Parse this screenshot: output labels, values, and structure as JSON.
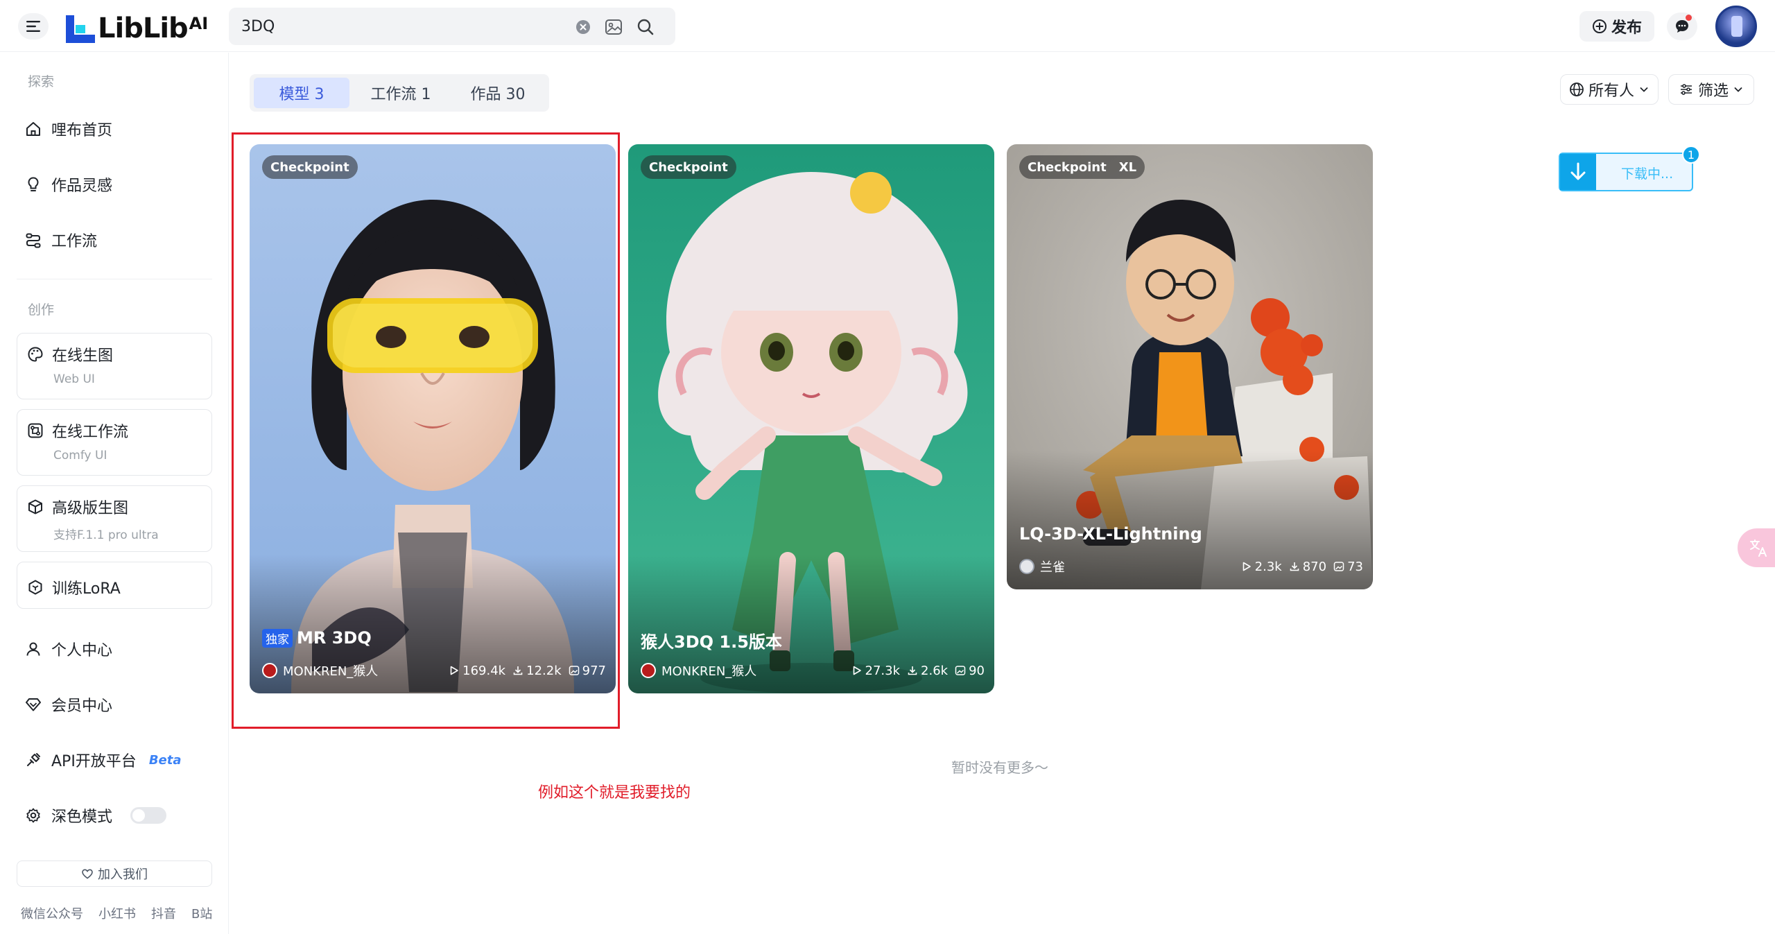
{
  "header": {
    "logo_text": "LibLib",
    "logo_sup": "AI",
    "search_value": "3DQ",
    "publish_label": "发布"
  },
  "sidebar": {
    "section_explore": "探索",
    "explore": [
      {
        "label": "哩布首页"
      },
      {
        "label": "作品灵感"
      },
      {
        "label": "工作流"
      }
    ],
    "section_create": "创作",
    "create": [
      {
        "label": "在线生图",
        "sub": "Web UI"
      },
      {
        "label": "在线工作流",
        "sub": "Comfy UI"
      },
      {
        "label": "高级版生图",
        "sub": "支持F.1.1 pro ultra"
      },
      {
        "label": "训练LoRA"
      }
    ],
    "personal": "个人中心",
    "member": "会员中心",
    "api": "API开放平台",
    "api_beta": "Beta",
    "dark_mode": "深色模式",
    "join": "加入我们",
    "footer": [
      "微信公众号",
      "小红书",
      "抖音",
      "B站"
    ]
  },
  "tabs": [
    {
      "label": "模型 3",
      "active": true
    },
    {
      "label": "工作流 1",
      "active": false
    },
    {
      "label": "作品 30",
      "active": false
    }
  ],
  "filters": {
    "owner": "所有人",
    "filter": "筛选"
  },
  "download": {
    "label": "下载中...",
    "count": "1"
  },
  "cards": [
    {
      "badge": "Checkpoint",
      "badge_extra": "",
      "exclusive": "独家",
      "title": "MR 3DQ",
      "author": "MONKREN_猴人",
      "runs": "169.4k",
      "downloads": "12.2k",
      "images": "977"
    },
    {
      "badge": "Checkpoint",
      "badge_extra": "",
      "exclusive": "",
      "title": "猴人3DQ 1.5版本",
      "author": "MONKREN_猴人",
      "runs": "27.3k",
      "downloads": "2.6k",
      "images": "90"
    },
    {
      "badge": "Checkpoint",
      "badge_extra": "XL",
      "exclusive": "",
      "title": "LQ-3D-XL-Lightning",
      "author": "兰雀",
      "runs": "2.3k",
      "downloads": "870",
      "images": "73"
    }
  ],
  "no_more": "暂时没有更多～",
  "annotation": "例如这个就是我要找的",
  "colors": {
    "accent": "#3b5bdb",
    "annotation_red": "#e11d2a",
    "download_blue": "#0ea5e9"
  }
}
